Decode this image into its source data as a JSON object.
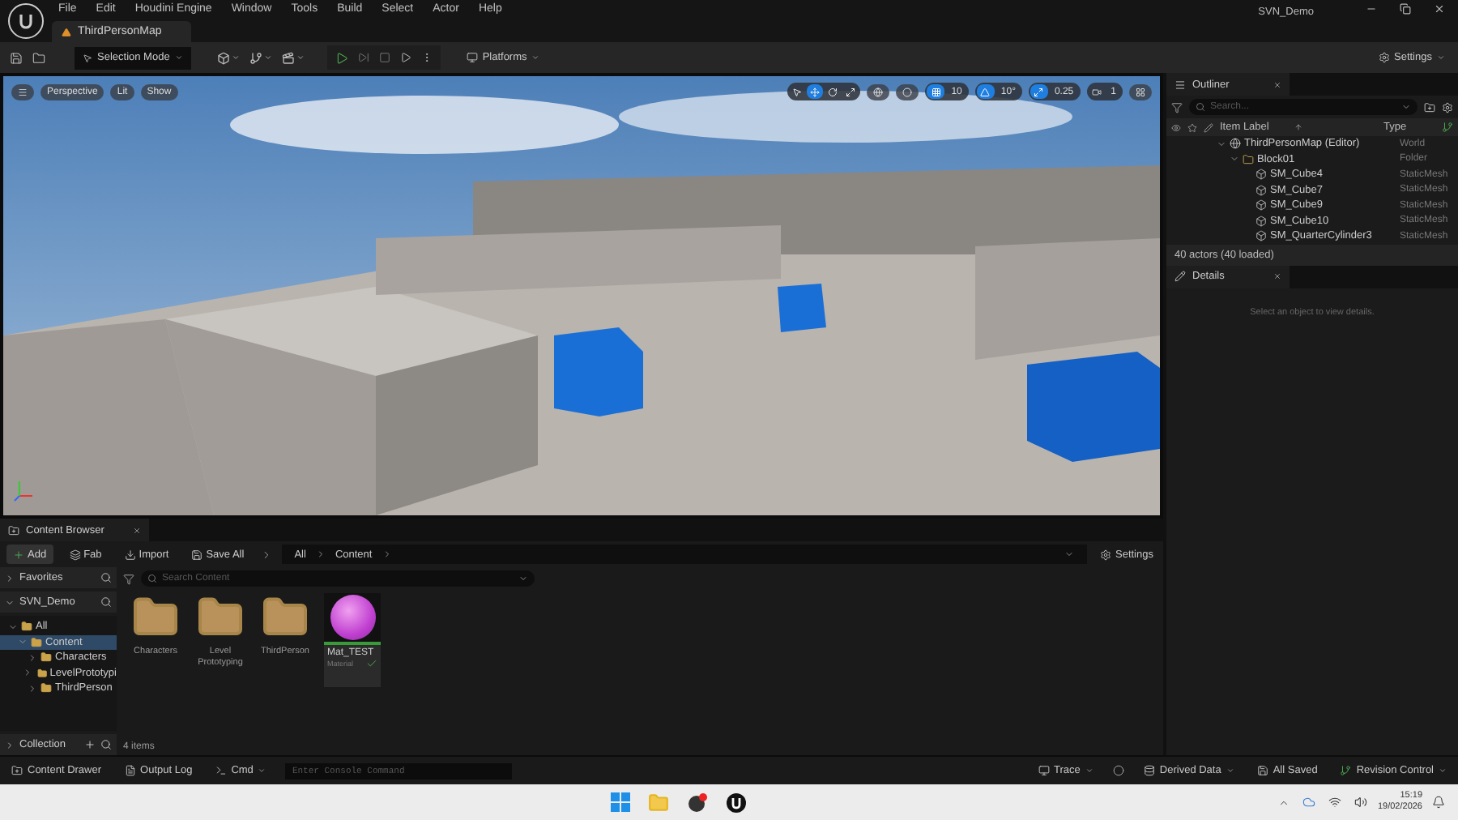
{
  "menu": [
    "File",
    "Edit",
    "Houdini Engine",
    "Window",
    "Tools",
    "Build",
    "Select",
    "Actor",
    "Help"
  ],
  "project": "SVN_Demo",
  "level_tab": {
    "label": "ThirdPersonMap",
    "selected": true
  },
  "toolbar": {
    "mode": "Selection Mode",
    "platforms": "Platforms",
    "settings": "Settings"
  },
  "viewport": {
    "buttons": [
      "Perspective",
      "Lit",
      "Show"
    ],
    "transform_tools": [
      {
        "kind": "select",
        "selected": false
      },
      {
        "kind": "translate",
        "selected": true
      },
      {
        "kind": "rotate",
        "selected": false
      },
      {
        "kind": "scale",
        "selected": false
      }
    ],
    "snaps": [
      {
        "kind": "grid",
        "value": "10",
        "on": true
      },
      {
        "kind": "rotation",
        "value": "10°",
        "on": true
      },
      {
        "kind": "scale",
        "value": "0.25",
        "on": true
      }
    ],
    "camera_speed": "1"
  },
  "outliner": {
    "title": "Outliner",
    "search": {
      "placeholder": "Search..."
    },
    "columns": [
      "Item Label",
      "Type"
    ],
    "rows": [
      {
        "label": "ThirdPersonMap (Editor)",
        "type": "World",
        "kind": "world",
        "expanded": true,
        "children": [
          {
            "label": "Block01",
            "type": "Folder",
            "kind": "folder",
            "expanded": true,
            "children": [
              {
                "label": "SM_Cube4",
                "type": "StaticMesh",
                "kind": "mesh"
              },
              {
                "label": "SM_Cube7",
                "type": "StaticMesh",
                "kind": "mesh"
              },
              {
                "label": "SM_Cube9",
                "type": "StaticMesh",
                "kind": "mesh"
              },
              {
                "label": "SM_Cube10",
                "type": "StaticMesh",
                "kind": "mesh"
              },
              {
                "label": "SM_QuarterCylinder3",
                "type": "StaticMesh",
                "kind": "mesh"
              }
            ]
          }
        ]
      }
    ],
    "footer": "40 actors (40 loaded)"
  },
  "details": {
    "title": "Details",
    "empty_text": "Select an object to view details."
  },
  "content_browser": {
    "title": "Content Browser",
    "actions": [
      {
        "kind": "add",
        "label": "Add"
      },
      {
        "kind": "fab",
        "label": "Fab"
      },
      {
        "kind": "import",
        "label": "Import"
      },
      {
        "kind": "save",
        "label": "Save All"
      }
    ],
    "path": [
      "All",
      "Content"
    ],
    "settings": "Settings",
    "sections": [
      {
        "label": "Favorites",
        "expanded": false
      },
      {
        "label": "SVN_Demo",
        "expanded": true
      }
    ],
    "tree": [
      {
        "label": "All",
        "expanded": true,
        "selected": false,
        "children": [
          {
            "label": "Content",
            "expanded": true,
            "selected": true,
            "children": [
              {
                "label": "Characters",
                "expanded": false,
                "selected": false
              },
              {
                "label": "LevelPrototypi",
                "expanded": false,
                "selected": false
              },
              {
                "label": "ThirdPerson",
                "expanded": false,
                "selected": false
              }
            ]
          }
        ]
      }
    ],
    "collections": "Collection",
    "search": {
      "placeholder": "Search Content"
    },
    "assets": [
      {
        "kind": "folder",
        "name": "Characters"
      },
      {
        "kind": "folder",
        "name": "Level Prototyping"
      },
      {
        "kind": "folder",
        "name": "ThirdPerson"
      },
      {
        "kind": "material",
        "name": "Mat_TEST",
        "type": "Material",
        "saved": true
      }
    ],
    "count": "4 items"
  },
  "status_bar": {
    "left": [
      "Content Drawer",
      "Output Log"
    ],
    "cmd": "Cmd",
    "console": {
      "placeholder": "Enter Console Command"
    },
    "trace": "Trace",
    "derived_data": "Derived Data",
    "saved": "All Saved",
    "revision": "Revision Control"
  },
  "taskbar": {
    "time": "15:19",
    "date": "19/02/2026"
  }
}
